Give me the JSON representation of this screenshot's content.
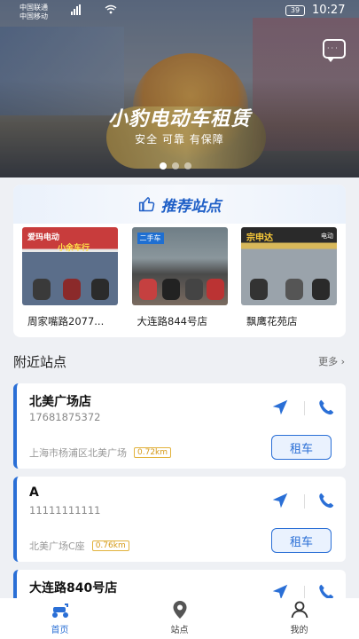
{
  "status_bar": {
    "carrier1": "中国联通",
    "carrier2": "中国移动",
    "battery": "39",
    "time": "10:27"
  },
  "banner": {
    "title": "小豹电动车租赁",
    "subtitle": "安全  可靠  有保障",
    "page_count": 3,
    "active_page": 1
  },
  "recommended": {
    "title": "推荐站点",
    "shops": [
      {
        "name": "周家嘴路2077...",
        "sign": "爱玛电动",
        "sign2": "小余车行"
      },
      {
        "name": "大连路844号店",
        "sign": "二手车"
      },
      {
        "name": "飘鹰花苑店",
        "sign": "宗申达",
        "sign2": "电动"
      }
    ]
  },
  "nearby": {
    "title": "附近站点",
    "more": "更多",
    "stations": [
      {
        "name": "北美广场店",
        "phone": "17681875372",
        "address": "上海市杨浦区北美广场",
        "distance": "0.72km",
        "action": "租车"
      },
      {
        "name": "A",
        "phone": "11111111111",
        "address": "北美广场C座",
        "distance": "0.76km",
        "action": "租车"
      },
      {
        "name": "大连路840号店",
        "phone": "",
        "address": "",
        "distance": "",
        "action": ""
      }
    ]
  },
  "tabbar": {
    "tabs": [
      {
        "label": "首页",
        "icon": "scooter-icon"
      },
      {
        "label": "站点",
        "icon": "location-pin-icon"
      },
      {
        "label": "我的",
        "icon": "user-icon"
      }
    ]
  },
  "colors": {
    "accent": "#2a6fd6",
    "distance": "#d59a1a"
  }
}
